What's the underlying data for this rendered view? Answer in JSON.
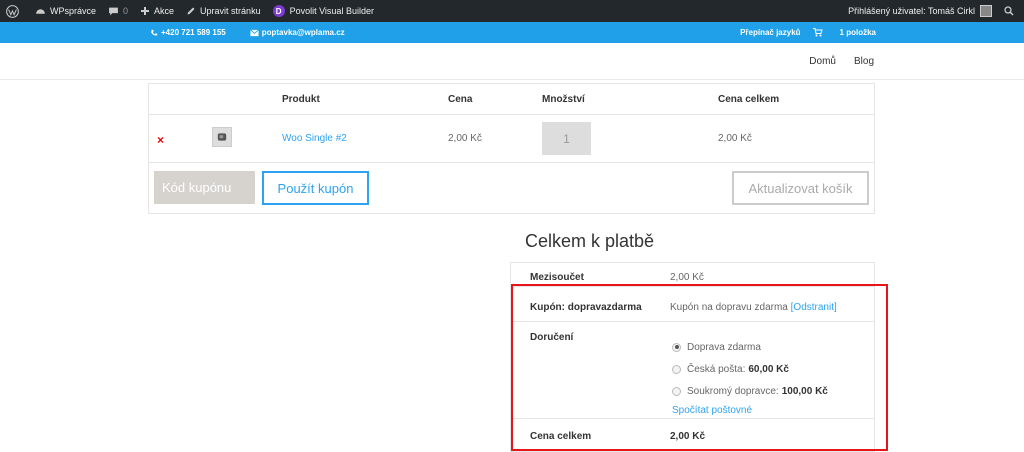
{
  "adminbar": {
    "site_name": "WPsprávce",
    "comments_count": "0",
    "new_label": "Akce",
    "edit_label": "Upravit stránku",
    "divi_letter": "D",
    "visual_builder_label": "Povolit Visual Builder",
    "user_greeting": "Přihlášený uživatel: Tomáš Cirkl"
  },
  "topheader": {
    "phone": "+420 721 589 155",
    "email": "poptavka@wplama.cz",
    "language_switcher": "Přepínač jazyků",
    "cart_count": "1 položka"
  },
  "nav": {
    "items": [
      "Domů",
      "Blog"
    ]
  },
  "cart": {
    "headers": {
      "product": "Produkt",
      "price": "Cena",
      "quantity": "Množství",
      "total": "Cena celkem"
    },
    "remove_symbol": "×",
    "item": {
      "name": "Woo Single #2",
      "price": "2,00 Kč",
      "quantity": "1",
      "subtotal": "2,00 Kč"
    },
    "coupon_placeholder": "Kód kupónu",
    "apply_coupon_label": "Použít kupón",
    "update_cart_label": "Aktualizovat košík"
  },
  "totals": {
    "title": "Celkem k platbě",
    "subtotal_label": "Mezisoučet",
    "subtotal_value": "2,00 Kč",
    "coupon_label": "Kupón: dopravazdarma",
    "coupon_value": "Kupón na dopravu zdarma",
    "coupon_remove": "[Odstranit]",
    "shipping_label": "Doručení",
    "shipping_options": [
      {
        "label": "Doprava zdarma",
        "price": "",
        "checked": true
      },
      {
        "label": "Česká pošta:",
        "price": "60,00 Kč",
        "checked": false
      },
      {
        "label": "Soukromý dopravce:",
        "price": "100,00 Kč",
        "checked": false
      }
    ],
    "calc_shipping": "Spočítat poštovné",
    "total_label": "Cena celkem",
    "total_value": "2,00 Kč"
  },
  "colors": {
    "accent": "#2ea3f2",
    "topbar": "#1fa0e8",
    "adminbar": "#23282d",
    "highlight": "#e8141a"
  }
}
